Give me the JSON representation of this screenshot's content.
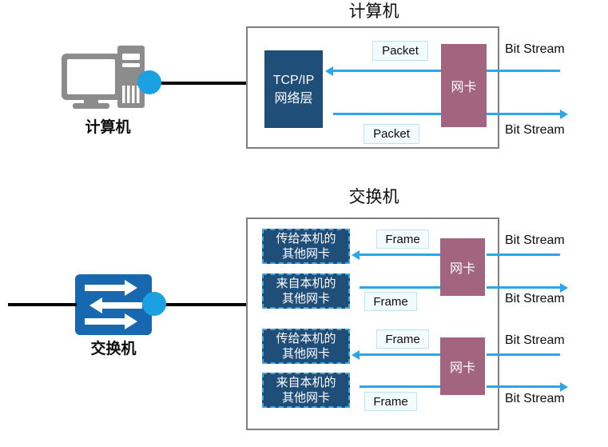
{
  "diagram": {
    "background": "#ffffff",
    "colors": {
      "navy": "#1F4E79",
      "mauve": "#A2647F",
      "flow_blue": "#2BA6E8",
      "dot_blue": "#1BA1E2",
      "container_gray": "#808080",
      "switch_icon_blue": "#1868B0",
      "pc_icon_gray": "#8C8C8C",
      "tag_fill": "#F2FBFE",
      "tag_border": "#BFE4F5"
    }
  },
  "computer_section": {
    "title": "计算机",
    "device": {
      "label": "计算机",
      "icon": "desktop-computer-icon",
      "port_dot": "network-port-dot"
    },
    "stack_box": {
      "line1": "TCP/IP",
      "line2": "网络层"
    },
    "nic": {
      "label": "网卡"
    },
    "flows": [
      {
        "direction": "inbound",
        "tag": "Packet",
        "outer_label": "Bit Stream"
      },
      {
        "direction": "outbound",
        "tag": "Packet",
        "outer_label": "Bit Stream"
      }
    ]
  },
  "switch_section": {
    "title": "交换机",
    "device": {
      "label": "交换机",
      "icon": "network-switch-icon",
      "port_dot": "network-port-dot"
    },
    "nic_groups": [
      {
        "nic": {
          "label": "网卡"
        },
        "flows": [
          {
            "direction": "inbound",
            "target_box": {
              "line1": "传给本机的",
              "line2": "其他网卡"
            },
            "tag": "Frame",
            "outer_label": "Bit Stream"
          },
          {
            "direction": "outbound",
            "target_box": {
              "line1": "来自本机的",
              "line2": "其他网卡"
            },
            "tag": "Frame",
            "outer_label": "Bit Stream"
          }
        ]
      },
      {
        "nic": {
          "label": "网卡"
        },
        "flows": [
          {
            "direction": "inbound",
            "target_box": {
              "line1": "传给本机的",
              "line2": "其他网卡"
            },
            "tag": "Frame",
            "outer_label": "Bit Stream"
          },
          {
            "direction": "outbound",
            "target_box": {
              "line1": "来自本机的",
              "line2": "其他网卡"
            },
            "tag": "Frame",
            "outer_label": "Bit Stream"
          }
        ]
      }
    ]
  }
}
